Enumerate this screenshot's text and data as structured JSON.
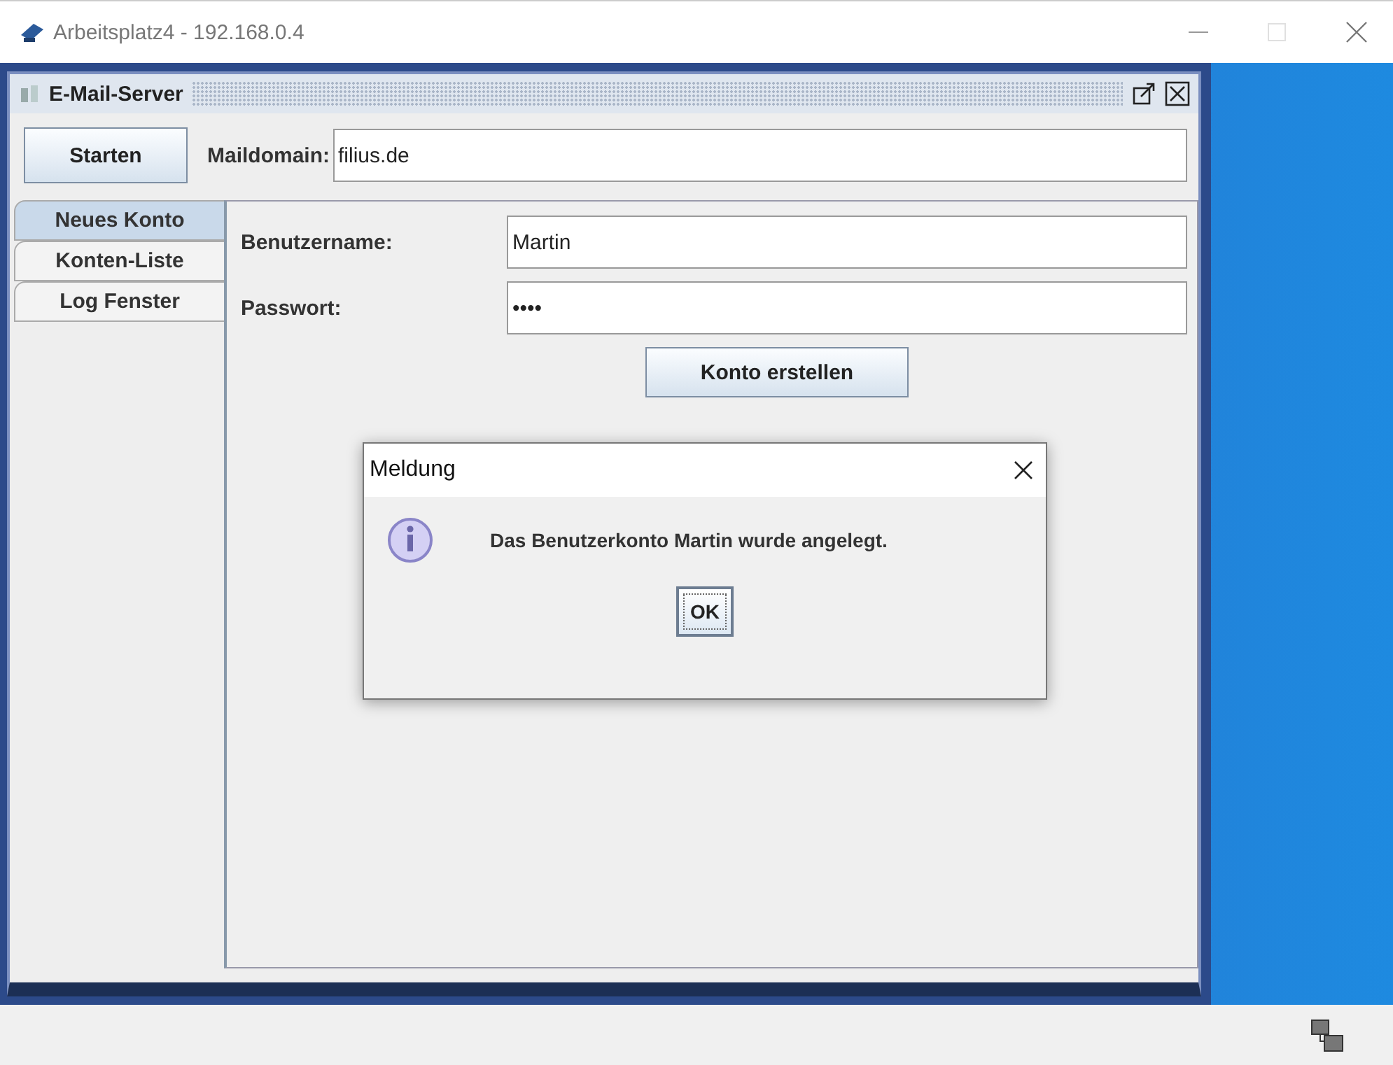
{
  "window": {
    "title": "Arbeitsplatz4 - 192.168.0.4"
  },
  "frame": {
    "title": "E-Mail-Server"
  },
  "toolbar": {
    "start_button": "Starten",
    "domain_label": "Maildomain:",
    "domain_value": "filius.de"
  },
  "tabs": [
    {
      "label": "Neues Konto",
      "selected": true
    },
    {
      "label": "Konten-Liste",
      "selected": false
    },
    {
      "label": "Log Fenster",
      "selected": false
    }
  ],
  "form": {
    "fields": [
      {
        "label": "Benutzername:",
        "value": "Martin"
      },
      {
        "label": "Passwort:",
        "value": "••••"
      }
    ],
    "button": "Konto erstellen"
  },
  "dialog": {
    "title": "Meldung",
    "message": "Das Benutzerkonto Martin wurde angelegt.",
    "button": "OK"
  }
}
